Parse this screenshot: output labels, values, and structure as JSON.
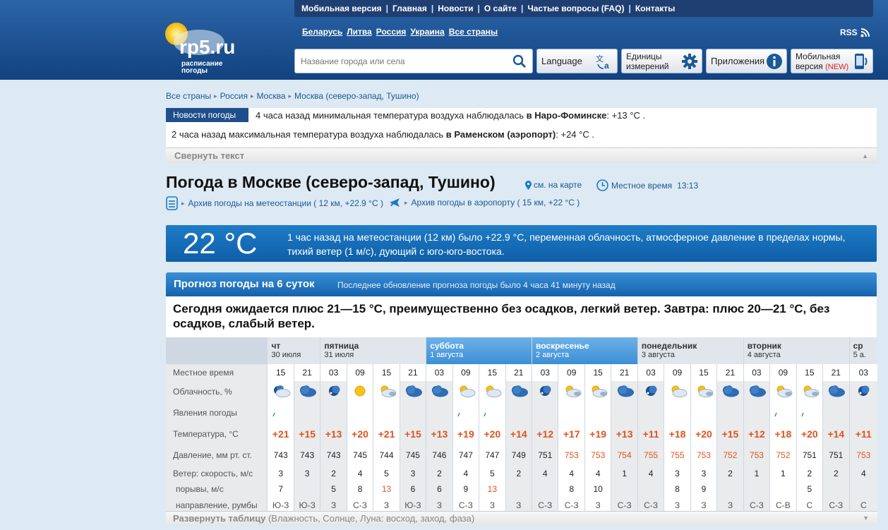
{
  "topnav": [
    "Мобильная версия",
    "Главная",
    "Новости",
    "О сайте",
    "Частые вопросы (FAQ)",
    "Контакты"
  ],
  "logo": {
    "text": "rp5.ru",
    "sub1": "расписание",
    "sub2": "погоды"
  },
  "countries": [
    "Беларусь",
    "Литва",
    "Россия",
    "Украина",
    "Все страны"
  ],
  "rss": "RSS",
  "search": {
    "placeholder": "Название города или села"
  },
  "buttons": {
    "language": "Language",
    "units1": "Единицы",
    "units2": "измерений",
    "apps": "Приложения",
    "mobile1": "Мобильная",
    "mobile2": "версия",
    "mobile_new": "(NEW)"
  },
  "breadcrumb": [
    "Все страны",
    "Россия",
    "Москва",
    "Москва (северо-запад, Тушино)"
  ],
  "news": {
    "badge": "Новости погоды",
    "item1_pre": "4 часа назад минимальная температура воздуха наблюдалась ",
    "item1_place": "в Наро-Фоминске",
    "item1_post": ": +13 °С .",
    "item2_pre": "2 часа назад максимальная температура воздуха наблюдалась ",
    "item2_place": "в Раменском (аэропорт)",
    "item2_post": ": +24 °С .",
    "collapse": "Свернуть текст"
  },
  "title": "Погода в Москве (северо-запад, Тушино)",
  "maplink": "см. на карте",
  "localtime_label": "Местное время",
  "localtime": "13:13",
  "archive_station": "Архив погоды на метеостанции ( 12 км, +22.9 °С )",
  "archive_airport": "Архив погоды в аэропорту ( 15 км, +22 °С )",
  "current": {
    "temp": "22 °C",
    "desc": "1 час назад на метеостанции (12 км) было +22.9 °С, переменная облачность, атмосферное давление в пределах нормы, тихий ветер (1 м/с), дующий с юго-юго-востока."
  },
  "forecast": {
    "title": "Прогноз погоды на 6 суток",
    "updated": "Последнее обновление прогноза погоды было 4 часа 41 минуту назад",
    "summary": "Сегодня ожидается плюс 21—15 °С, преимущественно без осадков, легкий ветер. Завтра: плюс 20—21 °С, без осадков, слабый ветер.",
    "row_labels": {
      "time": "Местное время",
      "cloud": "Облачность, %",
      "phen": "Явления погоды",
      "temp": "Температура, °С",
      "press": "Давление, мм рт. ст.",
      "wind": "Ветер: скорость, м/с",
      "gust": "порывы, м/с",
      "dir": "направление, румбы"
    },
    "days": [
      {
        "name": "чт",
        "date": "30 июля",
        "cols": 2,
        "blue": false
      },
      {
        "name": "пятница",
        "date": "31 июля",
        "cols": 4,
        "blue": false
      },
      {
        "name": "суббота",
        "date": "1 августа",
        "cols": 4,
        "blue": true
      },
      {
        "name": "воскресенье",
        "date": "2 августа",
        "cols": 4,
        "blue": true
      },
      {
        "name": "понедельник",
        "date": "3 августа",
        "cols": 4,
        "blue": false
      },
      {
        "name": "вторник",
        "date": "4 августа",
        "cols": 4,
        "blue": false
      },
      {
        "name": "ср",
        "date": "5 а.",
        "cols": 1,
        "blue": false
      }
    ],
    "times": [
      "15",
      "21",
      "03",
      "09",
      "15",
      "21",
      "03",
      "09",
      "15",
      "21",
      "03",
      "09",
      "15",
      "21",
      "03",
      "09",
      "15",
      "21",
      "03",
      "09",
      "15",
      "21",
      "03"
    ],
    "cloud_icons": [
      "partly-cloudy-night-icon",
      "cloudy-night-icon",
      "clear-night-icon",
      "sunny-icon",
      "partly-cloudy-icon",
      "cloudy-night-icon",
      "cloudy-night-icon",
      "partly-sunny-icon",
      "partly-sunny-icon",
      "cloudy-night-icon",
      "clear-night-icon",
      "partly-cloudy-icon",
      "partly-cloudy-icon",
      "cloudy-night-icon",
      "clear-night-icon",
      "partly-sunny-icon",
      "partly-cloudy-icon",
      "cloudy-night-icon",
      "cloudy-night-icon",
      "partly-cloudy-icon",
      "partly-cloudy-icon",
      "cloudy-night-icon",
      "clear-night-icon"
    ],
    "rain": [
      true,
      false,
      false,
      false,
      false,
      false,
      false,
      true,
      true,
      false,
      false,
      false,
      false,
      false,
      false,
      false,
      false,
      false,
      false,
      true,
      true,
      false,
      false
    ],
    "temps": [
      "+21",
      "+15",
      "+13",
      "+20",
      "+21",
      "+15",
      "+13",
      "+19",
      "+20",
      "+14",
      "+12",
      "+17",
      "+19",
      "+13",
      "+11",
      "+18",
      "+20",
      "+15",
      "+12",
      "+18",
      "+20",
      "+14",
      "+11"
    ],
    "pressure": [
      "743",
      "743",
      "743",
      "745",
      "744",
      "745",
      "746",
      "747",
      "747",
      "749",
      "751",
      "753",
      "753",
      "754",
      "755",
      "755",
      "753",
      "752",
      "753",
      "752",
      "751",
      "751",
      "753"
    ],
    "pressure_red": [
      false,
      false,
      false,
      false,
      false,
      false,
      false,
      false,
      false,
      false,
      false,
      true,
      true,
      true,
      true,
      true,
      true,
      true,
      true,
      true,
      false,
      false,
      true
    ],
    "wind": [
      "3",
      "3",
      "2",
      "4",
      "5",
      "3",
      "2",
      "4",
      "5",
      "2",
      "4",
      "4",
      "4",
      "1",
      "4",
      "3",
      "3",
      "2",
      "1",
      "1",
      "2",
      "2",
      "4"
    ],
    "gust": [
      "7",
      "",
      "5",
      "8",
      "13",
      "6",
      "6",
      "9",
      "13",
      "",
      "",
      "8",
      "10",
      "",
      "",
      "8",
      "9",
      "",
      "",
      "",
      "5",
      "",
      ""
    ],
    "gust_red": [
      false,
      false,
      false,
      false,
      true,
      false,
      false,
      false,
      true,
      false,
      false,
      false,
      false,
      false,
      false,
      false,
      false,
      false,
      false,
      false,
      false,
      false,
      false
    ],
    "dir": [
      "Ю-З",
      "Ю-З",
      "З",
      "С-З",
      "З",
      "Ю-З",
      "З",
      "С-З",
      "З",
      "З",
      "С-З",
      "С-З",
      "З",
      "С-З",
      "С-З",
      "З",
      "З",
      "З",
      "С-З",
      "С-В",
      "С",
      "С-З",
      "С"
    ],
    "col_shade": [
      "white",
      "gray",
      "gray",
      "white",
      "white",
      "gray",
      "gray",
      "white",
      "white",
      "gray",
      "gray",
      "white",
      "white",
      "gray",
      "gray",
      "white",
      "white",
      "gray",
      "gray",
      "white",
      "white",
      "gray",
      "gray"
    ],
    "expand": "Развернуть таблицу",
    "expand_hint": " (Влажность, Солнце, Луна: восход, заход, фаза)"
  },
  "colors": {
    "header_dark": "#12427f",
    "accent_blue": "#1462ad",
    "temp_red": "#e0531e"
  }
}
